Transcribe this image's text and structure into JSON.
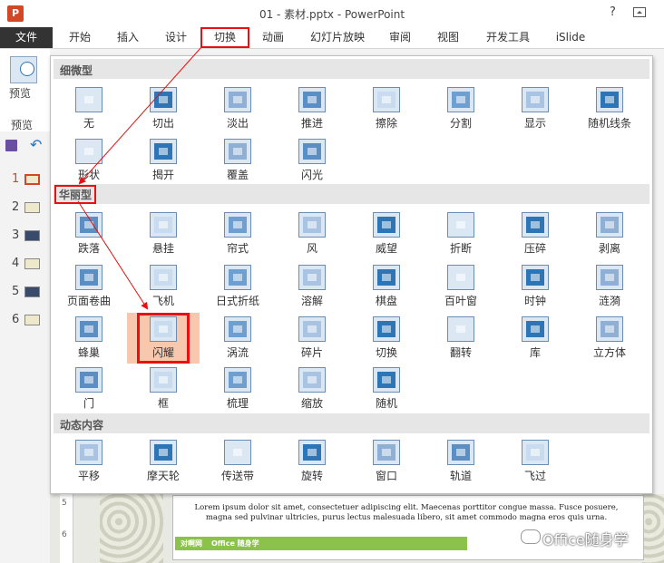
{
  "window": {
    "title": "01 - 素材.pptx - PowerPoint",
    "help": "?",
    "logo": "P"
  },
  "tabs": [
    {
      "id": "file",
      "label": "文件"
    },
    {
      "id": "home",
      "label": "开始"
    },
    {
      "id": "insert",
      "label": "插入"
    },
    {
      "id": "design",
      "label": "设计"
    },
    {
      "id": "transitions",
      "label": "切换"
    },
    {
      "id": "animations",
      "label": "动画"
    },
    {
      "id": "slideshow",
      "label": "幻灯片放映"
    },
    {
      "id": "review",
      "label": "审阅"
    },
    {
      "id": "view",
      "label": "视图"
    },
    {
      "id": "developer",
      "label": "开发工具"
    },
    {
      "id": "islide",
      "label": "iSlide"
    }
  ],
  "ribbon": {
    "preview_label": "预览",
    "group_label": "预览"
  },
  "slides": [
    "1",
    "2",
    "3",
    "4",
    "5",
    "6"
  ],
  "gallery": {
    "sections": [
      {
        "title": "细微型",
        "items": [
          "无",
          "切出",
          "淡出",
          "推进",
          "擦除",
          "分割",
          "显示",
          "随机线条",
          "形状",
          "揭开",
          "覆盖",
          "闪光"
        ]
      },
      {
        "title": "华丽型",
        "items": [
          "跌落",
          "悬挂",
          "帘式",
          "风",
          "威望",
          "折断",
          "压碎",
          "剥离",
          "页面卷曲",
          "飞机",
          "日式折纸",
          "溶解",
          "棋盘",
          "百叶窗",
          "时钟",
          "涟漪",
          "蜂巢",
          "闪耀",
          "涡流",
          "碎片",
          "切换",
          "翻转",
          "库",
          "立方体",
          "门",
          "框",
          "梳理",
          "缩放",
          "随机"
        ]
      },
      {
        "title": "动态内容",
        "items": [
          "平移",
          "摩天轮",
          "传送带",
          "旋转",
          "窗口",
          "轨道",
          "飞过"
        ]
      }
    ]
  },
  "slide_text": {
    "lorem": "Lorem ipsum dolor sit amet, consectetuer adipiscing elit. Maecenas porttitor congue massa. Fusce posuere, magna sed pulvinar ultricies, purus lectus malesuada libero, sit amet commodo magna eros quis urna.",
    "footer_left": "对啊网",
    "footer_right": "Office 随身学"
  },
  "ruler_marks": [
    "5",
    "6"
  ],
  "watermark": "Office随身学",
  "colors": {
    "accent": "#e81010",
    "ppt_orange": "#d24726",
    "icon_blue": "#2e75b6",
    "highlight": "#f8c8ae"
  }
}
